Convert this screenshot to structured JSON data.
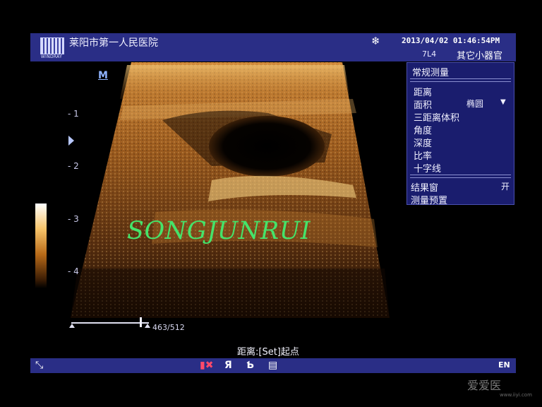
{
  "header": {
    "hospital": "莱阳市第一人民医院",
    "brand": "WINDRAY",
    "freeze_icon": "snowflake-icon",
    "datetime": "2013/04/02  01:46:54PM",
    "probe": "7L4",
    "preset": "其它小器官"
  },
  "menu": {
    "title": "常规测量",
    "items": [
      {
        "label": "距离"
      },
      {
        "label": "面积",
        "value": "椭圆"
      },
      {
        "label": "三距离体积"
      },
      {
        "label": "角度"
      },
      {
        "label": "深度"
      },
      {
        "label": "比率"
      },
      {
        "label": "十字线"
      }
    ],
    "result_window": {
      "label": "结果窗",
      "value": "开"
    },
    "preset": {
      "label": "测量预置"
    }
  },
  "image": {
    "mode_label": "M",
    "depth_ticks": [
      "- 1",
      "- 2",
      "- 3",
      "- 4"
    ],
    "overlay_text": "SONGJUNRUI",
    "cine_frames": "463/512"
  },
  "status": {
    "text": "距离:[Set]起点"
  },
  "bottombar": {
    "icons": [
      "resize-arrow-icon",
      "marker-icon",
      "flip-r-icon",
      "flip-b-icon",
      "page-icon"
    ],
    "glyphs": [
      "⤡",
      "▮✖",
      "Я",
      "Ƅ",
      "▤"
    ],
    "language": "EN"
  },
  "watermark": {
    "mark": "爱爱医",
    "url": "www.iiyi.com"
  }
}
